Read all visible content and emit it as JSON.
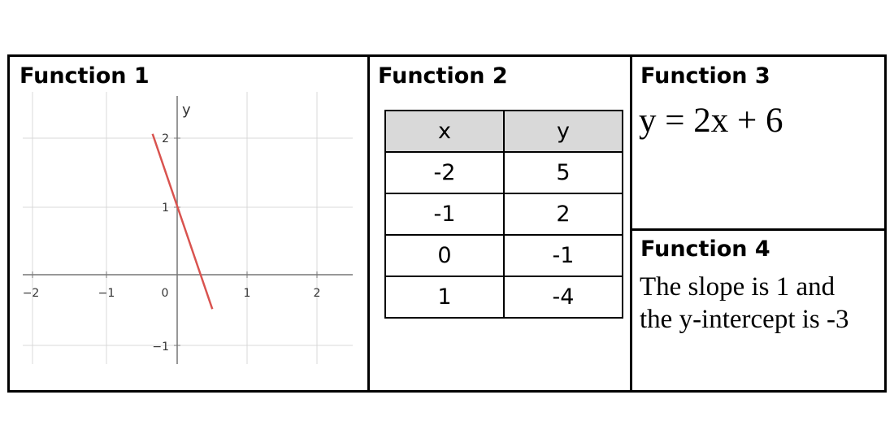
{
  "function1": {
    "heading": "Function 1",
    "graph": {
      "axis_label_y": "y",
      "x_ticks": [
        "−2",
        "−1",
        "0",
        "1",
        "2"
      ],
      "y_ticks": [
        "2",
        "1",
        "−1"
      ],
      "line": {
        "slope": -3,
        "intercept": 1,
        "color": "#d9534f"
      }
    }
  },
  "function2": {
    "heading": "Function 2",
    "table": {
      "headers": [
        "x",
        "y"
      ],
      "rows": [
        [
          "-2",
          "5"
        ],
        [
          "-1",
          "2"
        ],
        [
          "0",
          "-1"
        ],
        [
          "1",
          "-4"
        ]
      ]
    }
  },
  "function3": {
    "heading": "Function 3",
    "equation": "y = 2x + 6"
  },
  "function4": {
    "heading": "Function 4",
    "line1": "The slope is 1 and",
    "line2": "the y-intercept is -3"
  }
}
